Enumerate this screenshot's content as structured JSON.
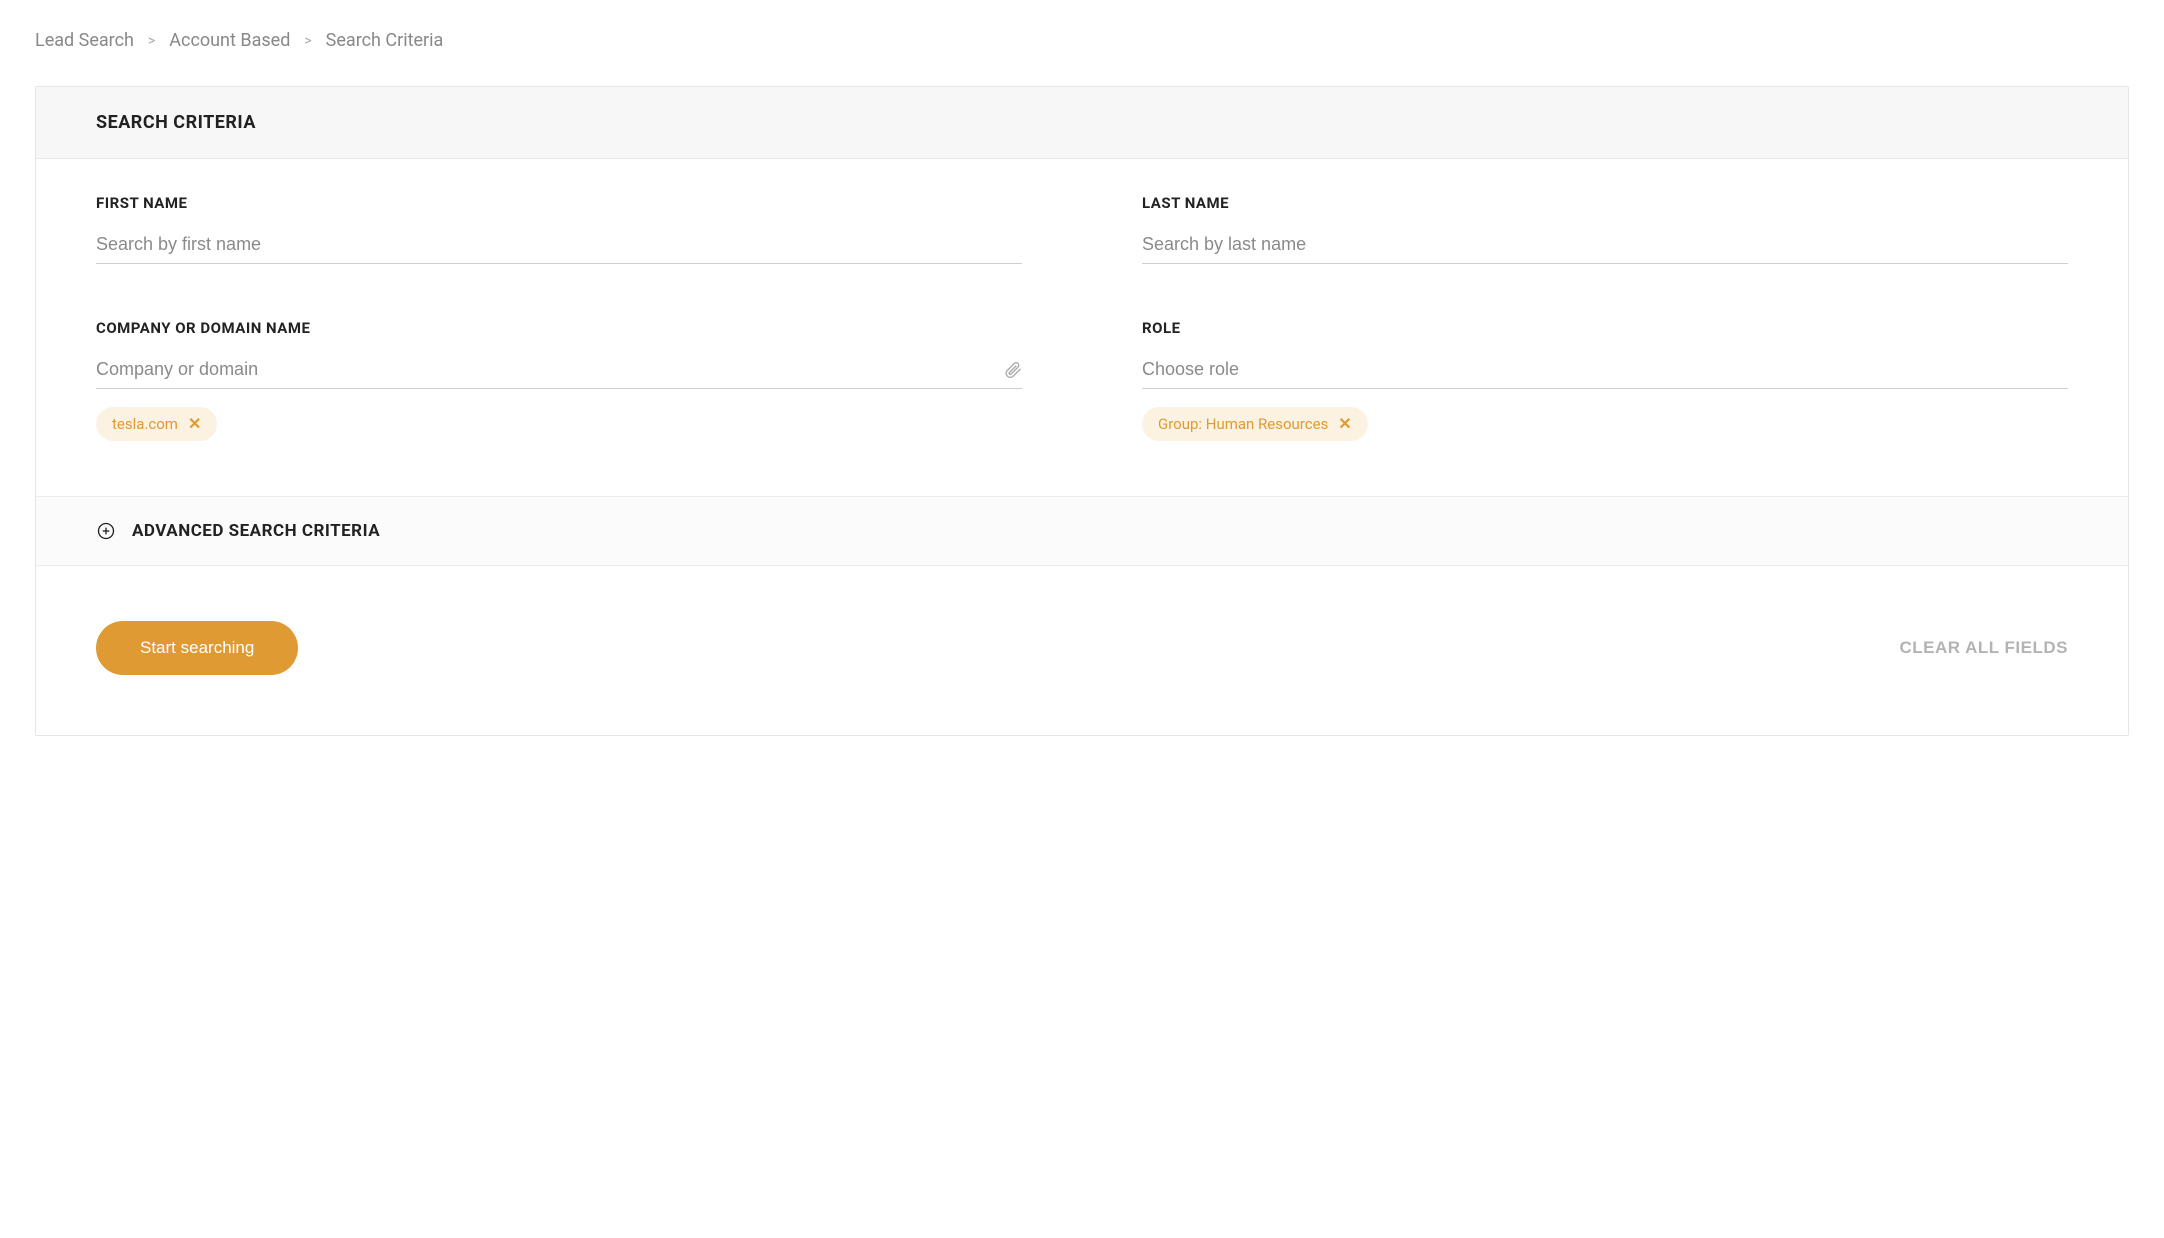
{
  "breadcrumb": {
    "items": [
      "Lead Search",
      "Account Based",
      "Search Criteria"
    ]
  },
  "panel": {
    "title": "SEARCH CRITERIA",
    "fields": {
      "first_name": {
        "label": "FIRST NAME",
        "placeholder": "Search by first name",
        "value": ""
      },
      "last_name": {
        "label": "LAST NAME",
        "placeholder": "Search by last name",
        "value": ""
      },
      "company": {
        "label": "COMPANY OR DOMAIN NAME",
        "placeholder": "Company or domain",
        "value": "",
        "chips": [
          "tesla.com"
        ]
      },
      "role": {
        "label": "ROLE",
        "placeholder": "Choose role",
        "value": "",
        "chips": [
          "Group: Human Resources"
        ]
      }
    },
    "advanced_title": "ADVANCED SEARCH CRITERIA"
  },
  "actions": {
    "start": "Start searching",
    "clear": "CLEAR ALL FIELDS"
  },
  "colors": {
    "accent": "#e09a33",
    "chip_bg": "#fcf2e2"
  }
}
